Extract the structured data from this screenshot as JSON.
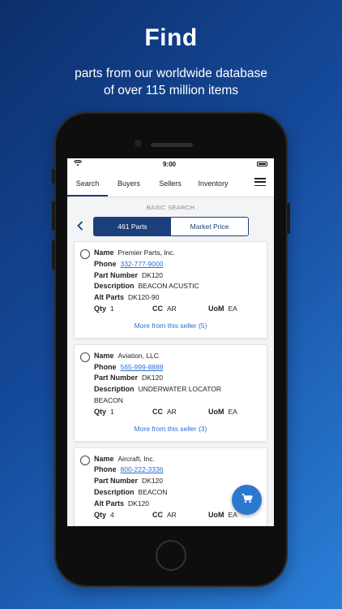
{
  "promo": {
    "headline": "Find",
    "subline_1": "parts from our worldwide database",
    "subline_2": "of over 115 million items"
  },
  "status_bar": {
    "time": "9:00"
  },
  "nav": {
    "tabs": [
      "Search",
      "Buyers",
      "Sellers",
      "Inventory"
    ],
    "active_tab": "Search"
  },
  "search": {
    "section_label": "BASIC SEARCH",
    "toggle_parts": "461 Parts",
    "toggle_market": "Market Price"
  },
  "labels": {
    "name": "Name",
    "phone": "Phone",
    "part_number": "Part Number",
    "description": "Description",
    "alt_parts": "Alt Parts",
    "qty": "Qty",
    "cc": "CC",
    "uom": "UoM"
  },
  "results": [
    {
      "name": "Premier Parts, Inc.",
      "phone": "332-777-9000",
      "part_number": "DK120",
      "description": "BEACON ACUSTIC",
      "alt_parts": "DK120-90",
      "qty": "1",
      "cc": "AR",
      "uom": "EA",
      "more": "More from this seller (5)"
    },
    {
      "name": "Aviation, LLC",
      "phone": "565-999-8888",
      "part_number": "DK120",
      "description": "UNDERWATER LOCATOR",
      "description_2": "BEACON",
      "qty": "1",
      "cc": "AR",
      "uom": "EA",
      "more": "More from this seller (3)"
    },
    {
      "name": "Aircraft, Inc.",
      "phone": "800-222-3336",
      "part_number": "DK120",
      "description": "BEACON",
      "alt_parts": "DK120",
      "qty": "4",
      "cc": "AR",
      "uom": "EA"
    }
  ],
  "colors": {
    "primary": "#1b3f7a",
    "link": "#2d6fd6",
    "fab": "#2b79cf"
  },
  "icons": [
    "wifi-icon",
    "battery-icon",
    "hamburger-menu-icon",
    "back-chevron-icon",
    "radio-icon",
    "cart-icon"
  ]
}
